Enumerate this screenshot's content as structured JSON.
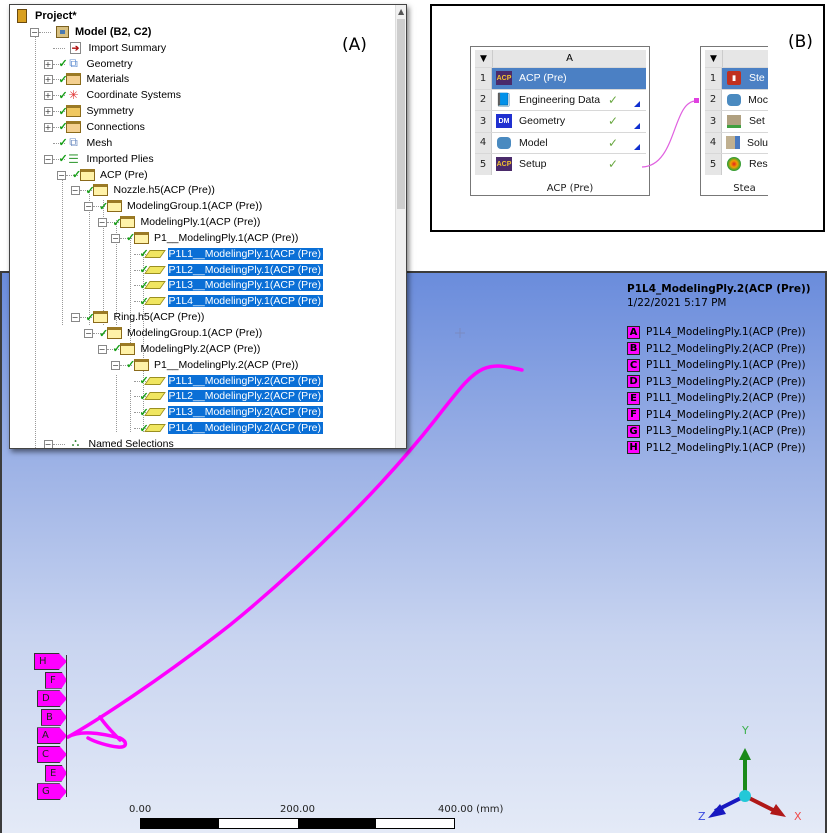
{
  "panel_a": {
    "label": "(A)",
    "tree": [
      {
        "text": "Project*",
        "icon": "project-icon",
        "bold": true,
        "check": false,
        "selected": false
      },
      {
        "text": "Model (B2, C2)",
        "icon": "model-icon",
        "bold": true,
        "check": false,
        "selected": false
      },
      {
        "text": "Import Summary",
        "icon": "import-summary-icon",
        "check": false,
        "selected": false
      },
      {
        "text": "Geometry",
        "icon": "geometry-icon",
        "check": true,
        "selected": false
      },
      {
        "text": "Materials",
        "icon": "materials-icon",
        "check": true,
        "selected": false
      },
      {
        "text": "Coordinate Systems",
        "icon": "coordinate-systems-icon",
        "check": true,
        "selected": false
      },
      {
        "text": "Symmetry",
        "icon": "symmetry-icon",
        "check": true,
        "selected": false
      },
      {
        "text": "Connections",
        "icon": "connections-icon",
        "check": true,
        "selected": false
      },
      {
        "text": "Mesh",
        "icon": "mesh-icon",
        "check": true,
        "selected": false
      },
      {
        "text": "Imported Plies",
        "icon": "imported-plies-icon",
        "check": true,
        "selected": false
      },
      {
        "text": "ACP (Pre)",
        "icon": "folder-icon",
        "check": true,
        "selected": false
      },
      {
        "text": "Nozzle.h5(ACP (Pre))",
        "icon": "folder-icon",
        "check": true,
        "selected": false
      },
      {
        "text": "ModelingGroup.1(ACP (Pre))",
        "icon": "folder-icon",
        "check": true,
        "selected": false
      },
      {
        "text": "ModelingPly.1(ACP (Pre))",
        "icon": "folder-icon",
        "check": true,
        "selected": false
      },
      {
        "text": "P1__ModelingPly.1(ACP (Pre))",
        "icon": "folder-icon",
        "check": true,
        "selected": false
      },
      {
        "text": "P1L1__ModelingPly.1(ACP (Pre)",
        "icon": "ply-icon",
        "check": true,
        "selected": true
      },
      {
        "text": "P1L2__ModelingPly.1(ACP (Pre)",
        "icon": "ply-icon",
        "check": true,
        "selected": true
      },
      {
        "text": "P1L3__ModelingPly.1(ACP (Pre)",
        "icon": "ply-icon",
        "check": true,
        "selected": true
      },
      {
        "text": "P1L4__ModelingPly.1(ACP (Pre)",
        "icon": "ply-icon",
        "check": true,
        "selected": true
      },
      {
        "text": "Ring.h5(ACP (Pre))",
        "icon": "folder-icon",
        "check": true,
        "selected": false
      },
      {
        "text": "ModelingGroup.1(ACP (Pre))",
        "icon": "folder-icon",
        "check": true,
        "selected": false
      },
      {
        "text": "ModelingPly.2(ACP (Pre))",
        "icon": "folder-icon",
        "check": true,
        "selected": false
      },
      {
        "text": "P1__ModelingPly.2(ACP (Pre))",
        "icon": "folder-icon",
        "check": true,
        "selected": false
      },
      {
        "text": "P1L1__ModelingPly.2(ACP (Pre)",
        "icon": "ply-icon",
        "check": true,
        "selected": true
      },
      {
        "text": "P1L2__ModelingPly.2(ACP (Pre)",
        "icon": "ply-icon",
        "check": true,
        "selected": true
      },
      {
        "text": "P1L3__ModelingPly.2(ACP (Pre)",
        "icon": "ply-icon",
        "check": true,
        "selected": true
      },
      {
        "text": "P1L4__ModelingPly.2(ACP (Pre)",
        "icon": "ply-icon",
        "check": true,
        "selected": true
      },
      {
        "text": "Named Selections",
        "icon": "named-selections-icon",
        "check": false,
        "selected": false
      }
    ]
  },
  "panel_b": {
    "label": "(B)",
    "system_a": {
      "column": "A",
      "caption": "ACP (Pre)",
      "rows": [
        {
          "num": "1",
          "label": "ACP (Pre)",
          "icon": "acp-icon",
          "check": false,
          "tri": false,
          "highlight": true
        },
        {
          "num": "2",
          "label": "Engineering Data",
          "icon": "engineering-data-icon",
          "check": true,
          "tri": true,
          "highlight": false
        },
        {
          "num": "3",
          "label": "Geometry",
          "icon": "designmodeler-icon",
          "check": true,
          "tri": true,
          "highlight": false
        },
        {
          "num": "4",
          "label": "Model",
          "icon": "model-icon",
          "check": true,
          "tri": true,
          "highlight": false
        },
        {
          "num": "5",
          "label": "Setup",
          "icon": "acp-icon",
          "check": true,
          "tri": false,
          "highlight": false
        }
      ]
    },
    "system_b": {
      "column": "",
      "caption": "Stea",
      "rows": [
        {
          "num": "1",
          "label": "Ste",
          "icon": "steady-state-thermal-icon",
          "highlight": true
        },
        {
          "num": "2",
          "label": "Moc",
          "icon": "model-icon",
          "highlight": false
        },
        {
          "num": "3",
          "label": "Set",
          "icon": "setup-icon",
          "highlight": false
        },
        {
          "num": "4",
          "label": "Solu",
          "icon": "solution-icon",
          "highlight": false
        },
        {
          "num": "5",
          "label": "Res",
          "icon": "results-icon",
          "highlight": false
        }
      ]
    },
    "link_color": "#e060e0"
  },
  "viewer": {
    "title": "P1L4_ModelingPly.2(ACP (Pre))",
    "timestamp": "1/22/2021 5:17 PM",
    "highlight_color": "#ff00ff",
    "legend": [
      {
        "key": "A",
        "label": "P1L4_ModelingPly.1(ACP (Pre))"
      },
      {
        "key": "B",
        "label": "P1L2_ModelingPly.2(ACP (Pre))"
      },
      {
        "key": "C",
        "label": "P1L1_ModelingPly.1(ACP (Pre))"
      },
      {
        "key": "D",
        "label": "P1L3_ModelingPly.2(ACP (Pre))"
      },
      {
        "key": "E",
        "label": "P1L1_ModelingPly.2(ACP (Pre))"
      },
      {
        "key": "F",
        "label": "P1L4_ModelingPly.2(ACP (Pre))"
      },
      {
        "key": "G",
        "label": "P1L3_ModelingPly.1(ACP (Pre))"
      },
      {
        "key": "H",
        "label": "P1L2_ModelingPly.1(ACP (Pre))"
      }
    ],
    "tags": [
      "H",
      "F",
      "D",
      "B",
      "A",
      "C",
      "E",
      "G"
    ],
    "scale": {
      "labels": [
        "0.00",
        "200.00",
        "400.00 (mm)"
      ]
    },
    "triad": {
      "x": "X",
      "y": "Y",
      "z": "Z"
    }
  }
}
